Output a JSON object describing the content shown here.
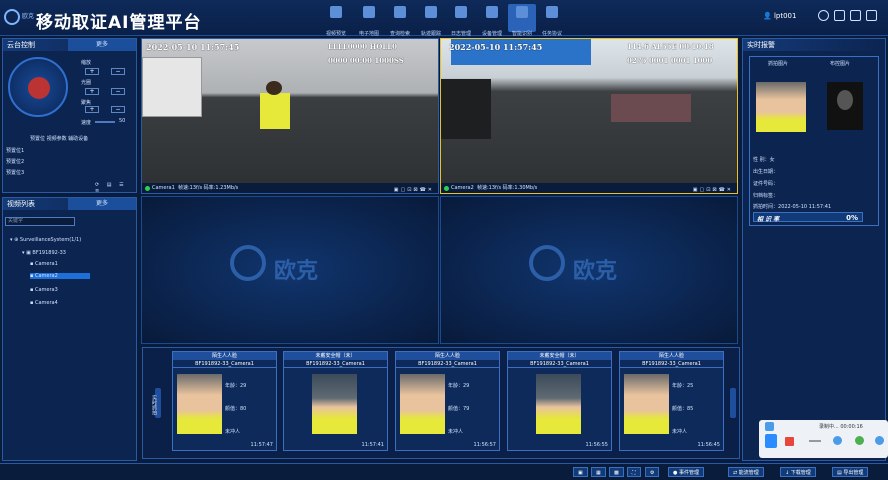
{
  "header": {
    "brand": "欧克",
    "title": "移动取证AI管理平台",
    "nav": [
      {
        "label": "视频预览",
        "active": false
      },
      {
        "label": "电子地图",
        "active": false
      },
      {
        "label": "查询检索",
        "active": false
      },
      {
        "label": "轨迹跟踪",
        "active": false
      },
      {
        "label": "日志管理",
        "active": false
      },
      {
        "label": "设备管理",
        "active": false
      },
      {
        "label": "智能识别",
        "active": true
      },
      {
        "label": "任务协议",
        "active": false
      }
    ],
    "user": "lpt001"
  },
  "ptz": {
    "title": "云台控制",
    "more": "更多",
    "zoom_label": "缩放",
    "focus_label": "光圈",
    "aperture_label": "聚焦",
    "speed_label": "速度",
    "speed_value": "50",
    "tabs_text": "预置位  视频参数  辅助设备",
    "presets": [
      "预置位1",
      "预置位2",
      "预置位3"
    ]
  },
  "videolist": {
    "title": "视频列表",
    "more": "更多",
    "search_placeholder": "关键字",
    "root": "SurveillanceSystem(1/1)",
    "device": "BF191892-33",
    "cameras": [
      "Camera1",
      "Camera2",
      "Camera3",
      "Camera4"
    ],
    "selected_index": 1
  },
  "videos": [
    {
      "osd_left": "2022-05-10 11:57:45",
      "osd_right_top": "LLLL0000 HOLL0",
      "osd_right_bottom": "0000 00:00 1000SS",
      "cam": "Camera1",
      "status": "帧速:13f/s  码率:1.23Mb/s"
    },
    {
      "osd_left": "2022-05-10 11:57:45",
      "osd_right_top": "114.6 AL55E 00:10:18",
      "osd_right_bottom": "0275 0001 0001 1000",
      "cam": "Camera2",
      "status": "帧速:13f/s  码率:1.30Mb/s"
    }
  ],
  "watermark": "欧克",
  "strip": {
    "sidetab": "实时抓拍",
    "cards": [
      {
        "type": "陌生人人脸",
        "name": "BF191892-33_Camera1",
        "age": "年龄：29",
        "score": "颜值：80",
        "tag": "未冲人",
        "time": "11:57:47",
        "kind": "face"
      },
      {
        "type": "未戴安全帽（未）",
        "name": "BF191892-33_Camera1",
        "age": "",
        "score": "",
        "tag": "",
        "time": "11:57:41",
        "kind": "body"
      },
      {
        "type": "陌生人人脸",
        "name": "BF191892-33_Camera1",
        "age": "年龄：29",
        "score": "颜值：79",
        "tag": "未冲人",
        "time": "11:56:57",
        "kind": "face"
      },
      {
        "type": "未戴安全帽（未）",
        "name": "BF191892-33_Camera1",
        "age": "",
        "score": "",
        "tag": "",
        "time": "11:56:55",
        "kind": "body"
      },
      {
        "type": "陌生人人脸",
        "name": "BF191892-33_Camera1",
        "age": "年龄：25",
        "score": "颜值：85",
        "tag": "未冲人",
        "time": "11:56:45",
        "kind": "face"
      }
    ]
  },
  "alarm": {
    "title": "实时报警",
    "capture_label": "抓拍图片",
    "match_label": "布控图片",
    "fields": [
      {
        "label": "性      别：",
        "value": "女"
      },
      {
        "label": "出生日期：",
        "value": ""
      },
      {
        "label": "证件号码：",
        "value": ""
      },
      {
        "label": "归档标签：",
        "value": ""
      },
      {
        "label": "抓拍时间：",
        "value": "2022-05-10 11:57:41"
      }
    ],
    "similarity_label": "相 识 率",
    "similarity": "0%"
  },
  "bottombar": {
    "buttons": [
      "事件管理",
      "能流管理",
      "下载管理",
      "导出管理"
    ]
  },
  "recorder": {
    "status": "录制中...  00:00:16"
  }
}
